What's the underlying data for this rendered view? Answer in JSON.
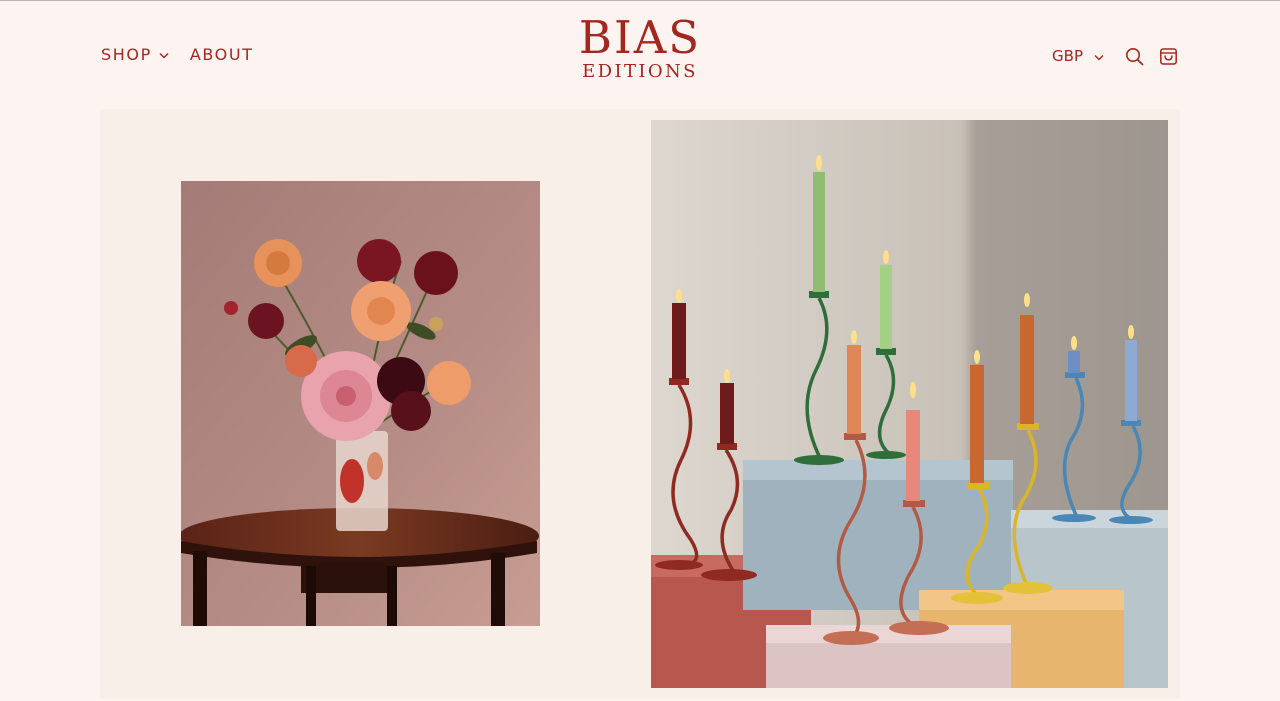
{
  "brand": {
    "name": "BIAS",
    "subtitle": "EDITIONS",
    "color": "#a4271f",
    "background": "#fdf3f1"
  },
  "nav": {
    "shop_label": "SHOP",
    "about_label": "ABOUT"
  },
  "header_actions": {
    "currency": "GBP",
    "search_icon": "search-icon",
    "cart_icon": "shopping-bag-icon"
  },
  "hero": {
    "background": "#f8f0e8",
    "images": [
      {
        "name": "dahlia-bouquet-photo",
        "description_icon": "photo"
      },
      {
        "name": "wavy-candlesticks-photo",
        "description_icon": "photo"
      }
    ]
  }
}
